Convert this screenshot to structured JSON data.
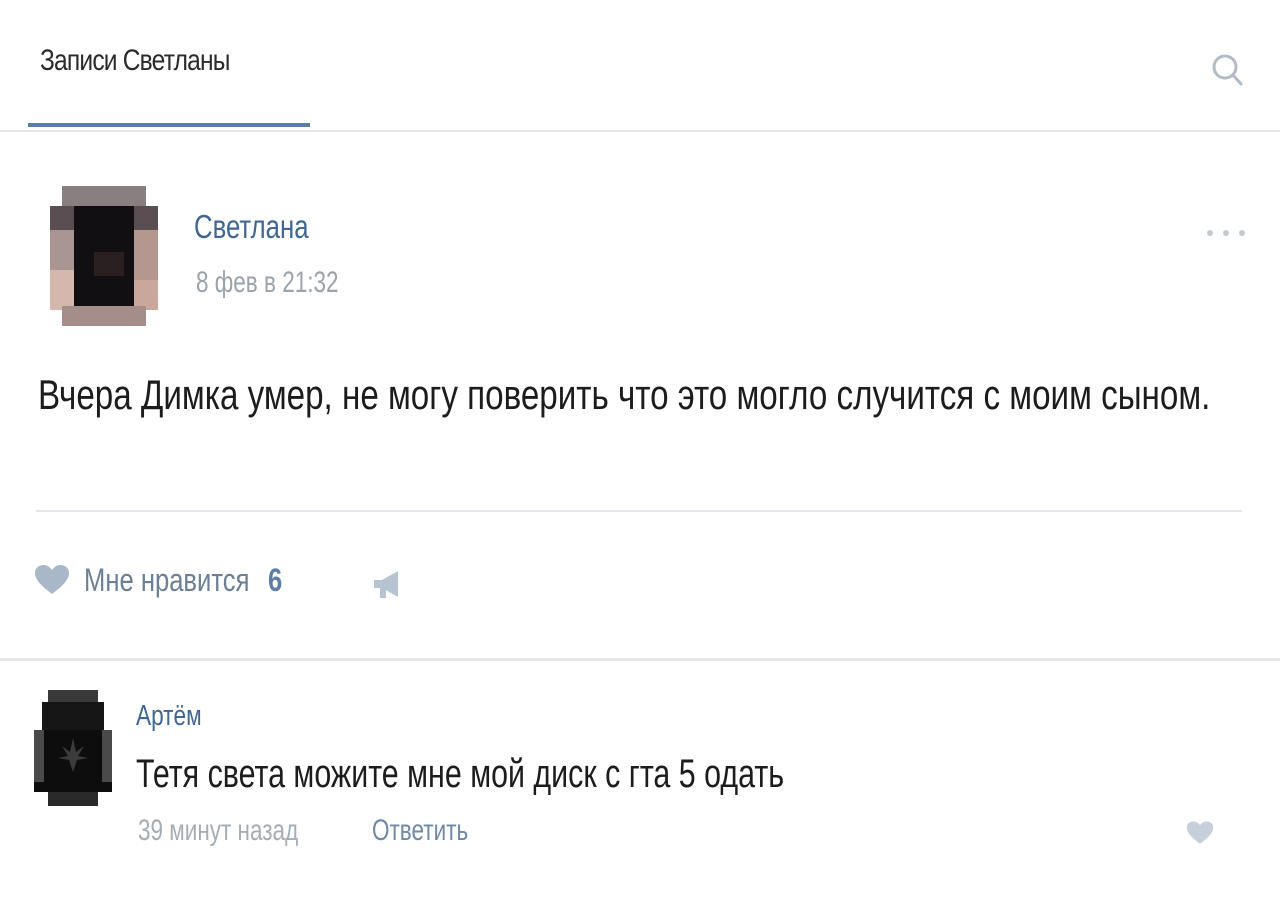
{
  "header": {
    "tab_label": "Записи Светланы"
  },
  "post": {
    "author": "Светлана",
    "date": "8 фев в 21:32",
    "text": "Вчера Димка умер, не могу поверить что это могло случится с моим сыном.",
    "likes_label": "Мне нравится",
    "likes_count": "6"
  },
  "comment": {
    "author": "Артём",
    "text": "Тетя света можите мне мой диск с гта 5 одать",
    "time": "39 минут назад",
    "reply_label": "Ответить"
  },
  "icons": {
    "search": "search-icon",
    "menu": "more-dots-icon",
    "like": "heart-icon",
    "share": "megaphone-icon",
    "comment_like": "heart-icon"
  },
  "colors": {
    "link": "#3f6694",
    "muted": "#9aa3ad",
    "accent": "#5b7ea6",
    "divider": "#e4e6ea"
  }
}
